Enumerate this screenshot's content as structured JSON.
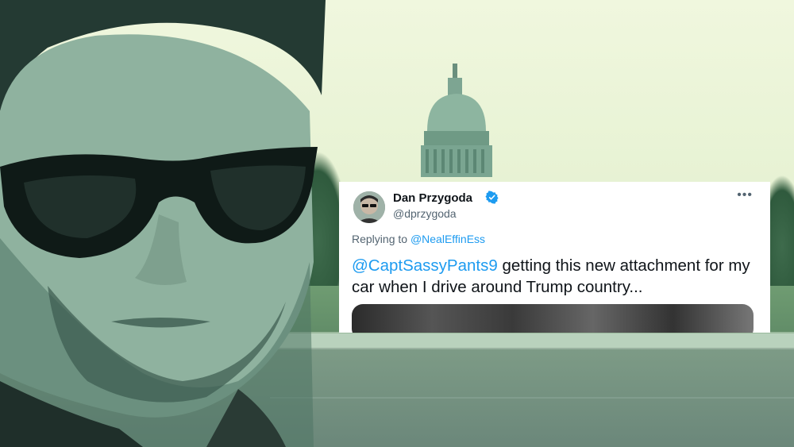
{
  "tweet": {
    "display_name": "Dan Przygoda",
    "handle": "@dprzygoda",
    "reply_prefix": "Replying to",
    "reply_to": "@NealEffinEss",
    "mention": "@CaptSassyPants9",
    "text": " getting this new attachment for my car when I drive around Trump country...",
    "more_label": "•••"
  },
  "colors": {
    "link": "#1d9bf0",
    "text": "#0f1419",
    "muted": "#536471"
  },
  "icons": [
    "verified-badge-icon",
    "more-options-icon"
  ]
}
